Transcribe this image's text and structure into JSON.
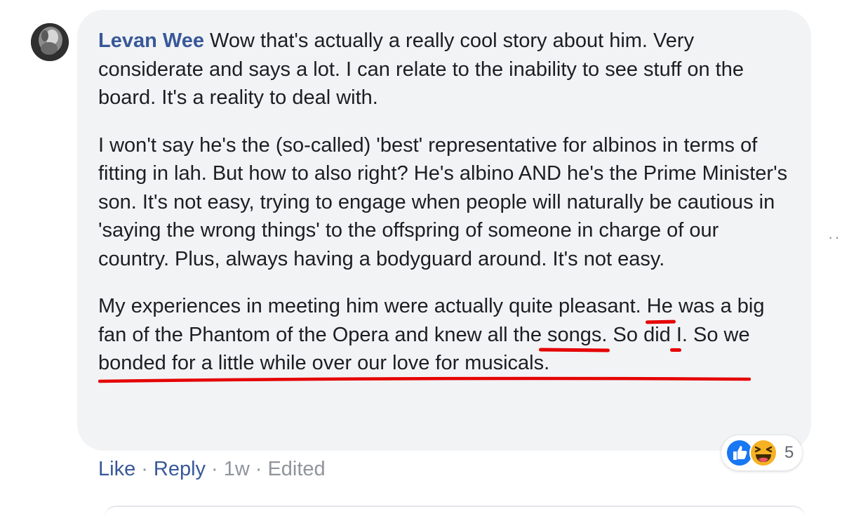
{
  "comment": {
    "author": "Levan Wee",
    "paragraphs": [
      "Wow that's actually a really cool story about him. Very considerate and says a lot. I can relate to the inability to see stuff on the board. It's a reality to deal with.",
      "I won't say he's the (so-called) 'best' representative for albinos in terms of fitting in lah. But how to also right? He's albino AND he's the Prime Minister's son. It's not easy, trying to engage when people will naturally be cautious in 'saying the wrong things' to the offspring of someone in charge of our country. Plus, always having a bodyguard around. It's not easy."
    ],
    "p3_before": "My experiences in meeting him were actually quite pleasant. ",
    "p3_ul1": "He",
    "p3_ul2": "was a big fan of the Phantom of the Opera and knew all the",
    "p3_ul3": "songs.",
    "p3_after": " So did I. So we bonded for a little while over our love for musicals."
  },
  "actions": {
    "like": "Like",
    "reply": "Reply",
    "time": "1w",
    "edited": "Edited",
    "separator": "·"
  },
  "reactions": {
    "icons": [
      "like-reaction-icon",
      "haha-reaction-icon"
    ],
    "count": "5"
  },
  "more_options": "···",
  "colors": {
    "bubble": "#f2f3f5",
    "author": "#385898",
    "link": "#385898",
    "meta": "#90949c",
    "annotation": "#e50000",
    "like_blue": "#1877f2",
    "haha_yellow": "#f7b125"
  }
}
